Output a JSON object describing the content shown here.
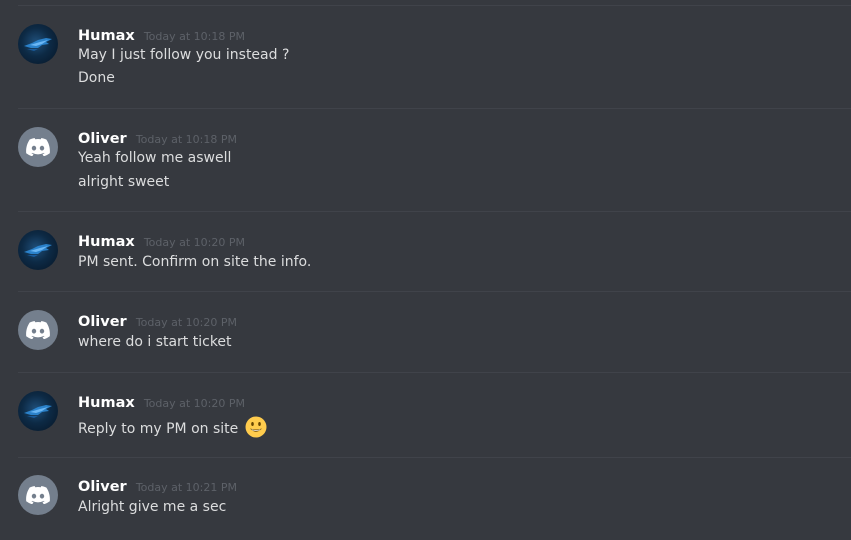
{
  "messages": [
    {
      "author": "Humax",
      "timestamp": "Today at 10:18 PM",
      "lines": [
        "May I just follow you instead ?",
        "Done"
      ]
    },
    {
      "author": "Oliver",
      "timestamp": "Today at 10:18 PM",
      "lines": [
        "Yeah follow me aswell",
        "alright sweet"
      ]
    },
    {
      "author": "Humax",
      "timestamp": "Today at 10:20 PM",
      "lines": [
        "PM sent. Confirm on site the info."
      ]
    },
    {
      "author": "Oliver",
      "timestamp": "Today at 10:20 PM",
      "lines": [
        "where do i start ticket"
      ]
    },
    {
      "author": "Humax",
      "timestamp": "Today at 10:20 PM",
      "lines": [
        "Reply to my PM on site"
      ],
      "emoji": "smiley-emoji"
    },
    {
      "author": "Oliver",
      "timestamp": "Today at 10:21 PM",
      "lines": [
        "Alright give me a sec"
      ]
    }
  ],
  "colors": {
    "background": "#36393f",
    "username": "#ffffff",
    "timestamp": "#5d6168",
    "message_text": "#dcddde",
    "default_avatar": "#747f8d"
  },
  "icons": {
    "humax_avatar": "bird-logo-avatar",
    "oliver_avatar": "discord-default-avatar"
  }
}
